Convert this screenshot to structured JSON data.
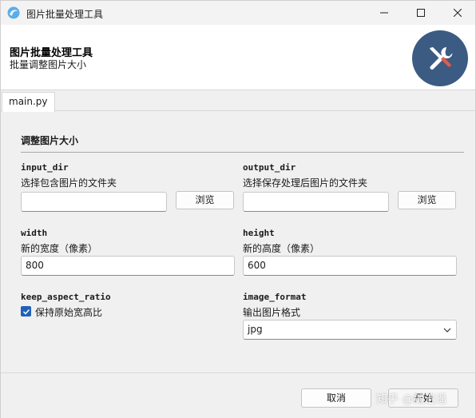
{
  "window": {
    "title": "图片批量处理工具"
  },
  "header": {
    "title": "图片批量处理工具",
    "subtitle": "批量调整图片大小",
    "logo_icon": "tools-icon",
    "logo_color": "#3b5b83"
  },
  "tabs": [
    {
      "label": "main.py",
      "active": true
    }
  ],
  "section": {
    "title": "调整图片大小"
  },
  "fields": {
    "input_dir": {
      "name": "input_dir",
      "description": "选择包含图片的文件夹",
      "value": "",
      "browse_label": "浏览"
    },
    "output_dir": {
      "name": "output_dir",
      "description": "选择保存处理后图片的文件夹",
      "value": "",
      "browse_label": "浏览"
    },
    "width": {
      "name": "width",
      "description": "新的宽度（像素）",
      "value": "800"
    },
    "height": {
      "name": "height",
      "description": "新的高度（像素）",
      "value": "600"
    },
    "keep_aspect_ratio": {
      "name": "keep_aspect_ratio",
      "checkbox_label": "保持原始宽高比",
      "checked": true
    },
    "image_format": {
      "name": "image_format",
      "description": "输出图片格式",
      "selected": "jpg"
    }
  },
  "footer": {
    "cancel_label": "取消",
    "run_label": "开始",
    "watermark": "知乎 @随逍遥"
  },
  "colors": {
    "accent": "#1f62b8"
  }
}
